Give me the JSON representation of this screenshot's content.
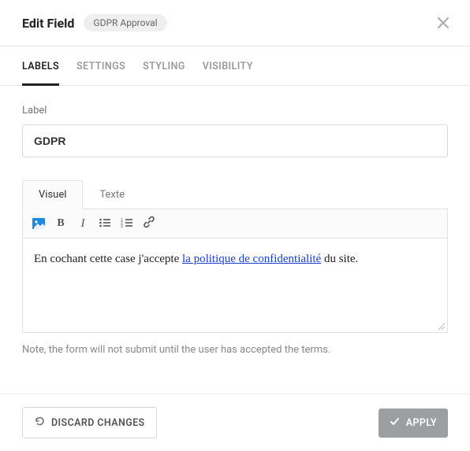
{
  "header": {
    "title": "Edit Field",
    "badge": "GDPR Approval"
  },
  "tabs": {
    "labels": "LABELS",
    "settings": "SETTINGS",
    "styling": "STYLING",
    "visibility": "VISIBILITY"
  },
  "label_field": {
    "caption": "Label",
    "value": "GDPR"
  },
  "editor": {
    "tab_visual": "Visuel",
    "tab_text": "Texte",
    "content_prefix": "En cochant cette case j'accepte ",
    "content_link": "la politique de confidentialité",
    "content_suffix": " du site."
  },
  "note": "Note, the form will not submit until the user has accepted the terms.",
  "footer": {
    "discard": "DISCARD CHANGES",
    "apply": "APPLY"
  }
}
